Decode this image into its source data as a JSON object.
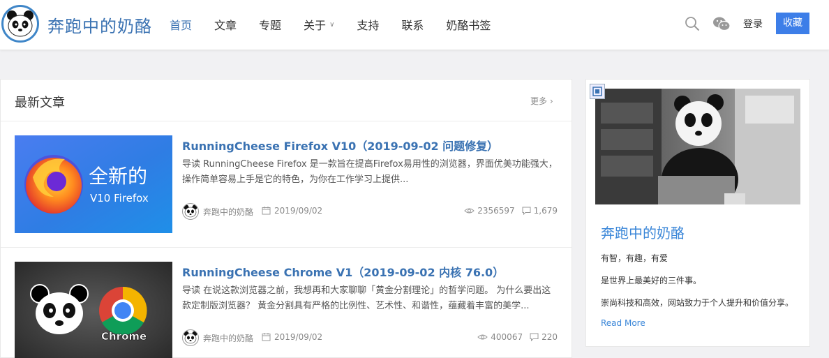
{
  "header": {
    "site_title": "奔跑中的奶酪",
    "nav": [
      {
        "label": "首页",
        "active": true
      },
      {
        "label": "文章",
        "active": false
      },
      {
        "label": "专题",
        "active": false
      },
      {
        "label": "关于",
        "active": false,
        "dropdown": true
      },
      {
        "label": "支持",
        "active": false
      },
      {
        "label": "联系",
        "active": false
      },
      {
        "label": "奶酪书签",
        "active": false
      }
    ],
    "icons": [
      "search-icon",
      "wechat-icon"
    ],
    "login_label": "登录",
    "collect_label": "收藏",
    "accent_color": "#3d7ee8"
  },
  "main": {
    "title": "最新文章",
    "more_label": "更多 ›",
    "posts": [
      {
        "title": "RunningCheese Firefox V10（2019-09-02 问题修复）",
        "excerpt": "导读 RunningCheese Firefox 是一款旨在提高Firefox易用性的浏览器，界面优美功能强大，操作简单容易上手是它的特色，为你在工作学习上提供...",
        "author": "奔跑中的奶酪",
        "date": "2019/09/02",
        "views": "2356597",
        "comments": "1,679",
        "thumb_text_1": "全新的",
        "thumb_text_2": "V10 Firefox"
      },
      {
        "title": "RunningCheese Chrome V1（2019-09-02 内核 76.0）",
        "excerpt": "导读 在说这款浏览器之前，我想再和大家聊聊「黄金分割理论」的哲学问题。 为什么要出这款定制版浏览器？ 黄金分割具有严格的比例性、艺术性、和谐性，蕴藏着丰富的美学...",
        "author": "奔跑中的奶酪",
        "date": "2019/09/02",
        "views": "400067",
        "comments": "220",
        "thumb_text_1": "Chrome"
      }
    ]
  },
  "sidebar": {
    "title": "奔跑中的奶酪",
    "lines": [
      "有智，有趣，有爱",
      "是世界上最美好的三件事。",
      "崇尚科技和高效，网站致力于个人提升和价值分享。"
    ],
    "read_more": "Read More"
  }
}
